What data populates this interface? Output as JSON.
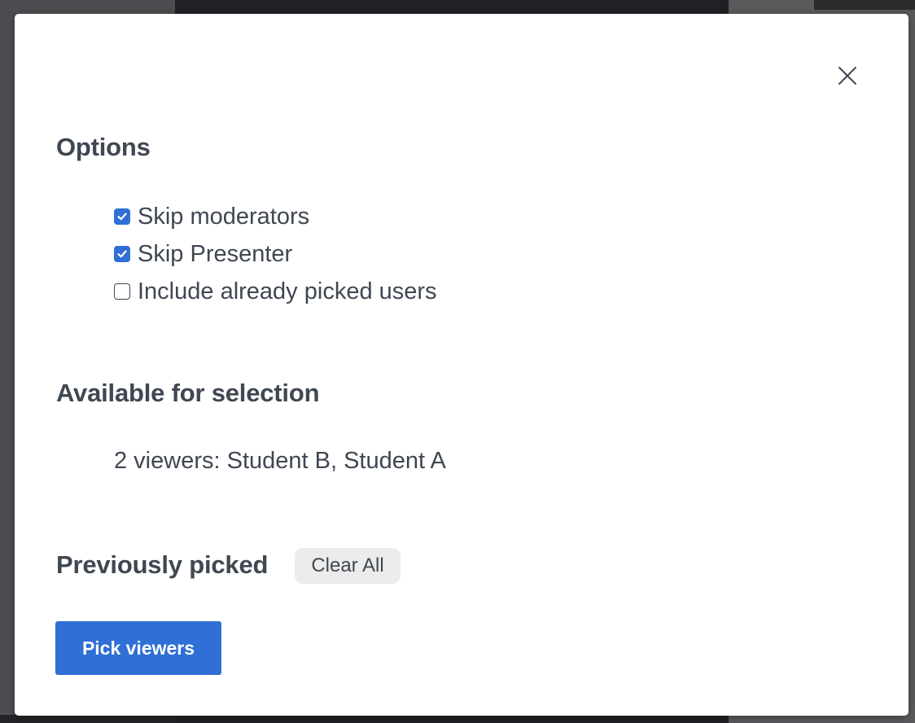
{
  "colors": {
    "accent": "#2f6fd6",
    "text": "#3f4752",
    "clear_button_bg": "#ececec",
    "modal_bg": "#ffffff"
  },
  "modal": {
    "close_icon": "close-icon",
    "options": {
      "title": "Options",
      "items": [
        {
          "label": "Skip moderators",
          "checked": true
        },
        {
          "label": "Skip Presenter",
          "checked": true
        },
        {
          "label": "Include already picked users",
          "checked": false
        }
      ]
    },
    "available": {
      "title": "Available for selection",
      "text": "2 viewers: Student B, Student A"
    },
    "previous": {
      "title": "Previously picked",
      "clear_label": "Clear All"
    },
    "pick_button_label": "Pick viewers"
  }
}
